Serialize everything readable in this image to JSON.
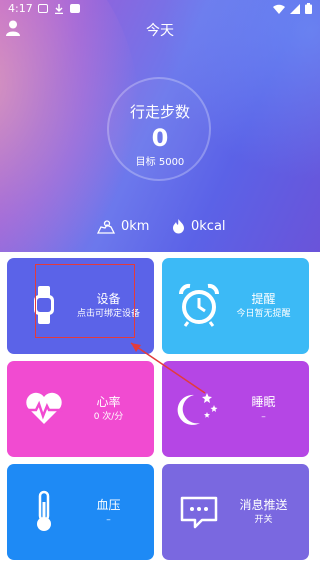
{
  "status": {
    "time": "4:17"
  },
  "header": {
    "title": "今天"
  },
  "summary": {
    "steps_label": "行走步数",
    "steps_value": "0",
    "goal_text": "目标 5000",
    "distance": "0km",
    "calories": "0kcal"
  },
  "tiles": {
    "device": {
      "title": "设备",
      "subtitle": "点击可绑定设备"
    },
    "alert": {
      "title": "提醒",
      "subtitle": "今日暂无提醒"
    },
    "heart": {
      "title": "心率",
      "subtitle": "0 次/分"
    },
    "sleep": {
      "title": "睡眠",
      "subtitle": "–"
    },
    "bp": {
      "title": "血压",
      "subtitle": "–"
    },
    "msg": {
      "title": "消息推送",
      "subtitle": "开关"
    }
  },
  "colors": {
    "device": "#5b63e8",
    "alert": "#3cbaf6",
    "heart": "#f14bd1",
    "sleep": "#b546e5",
    "bp": "#1e8af5",
    "msg": "#7a68e0",
    "annotation": "#e33b3b"
  },
  "icons": {
    "status_left": [
      "photo-icon",
      "download-icon",
      "square-icon"
    ],
    "status_right": [
      "wifi-icon",
      "signal-icon",
      "battery-icon"
    ],
    "tiles": [
      "smartwatch-icon",
      "alarm-clock-icon",
      "heart-rate-icon",
      "moon-stars-icon",
      "thermometer-icon",
      "chat-dots-icon"
    ]
  }
}
